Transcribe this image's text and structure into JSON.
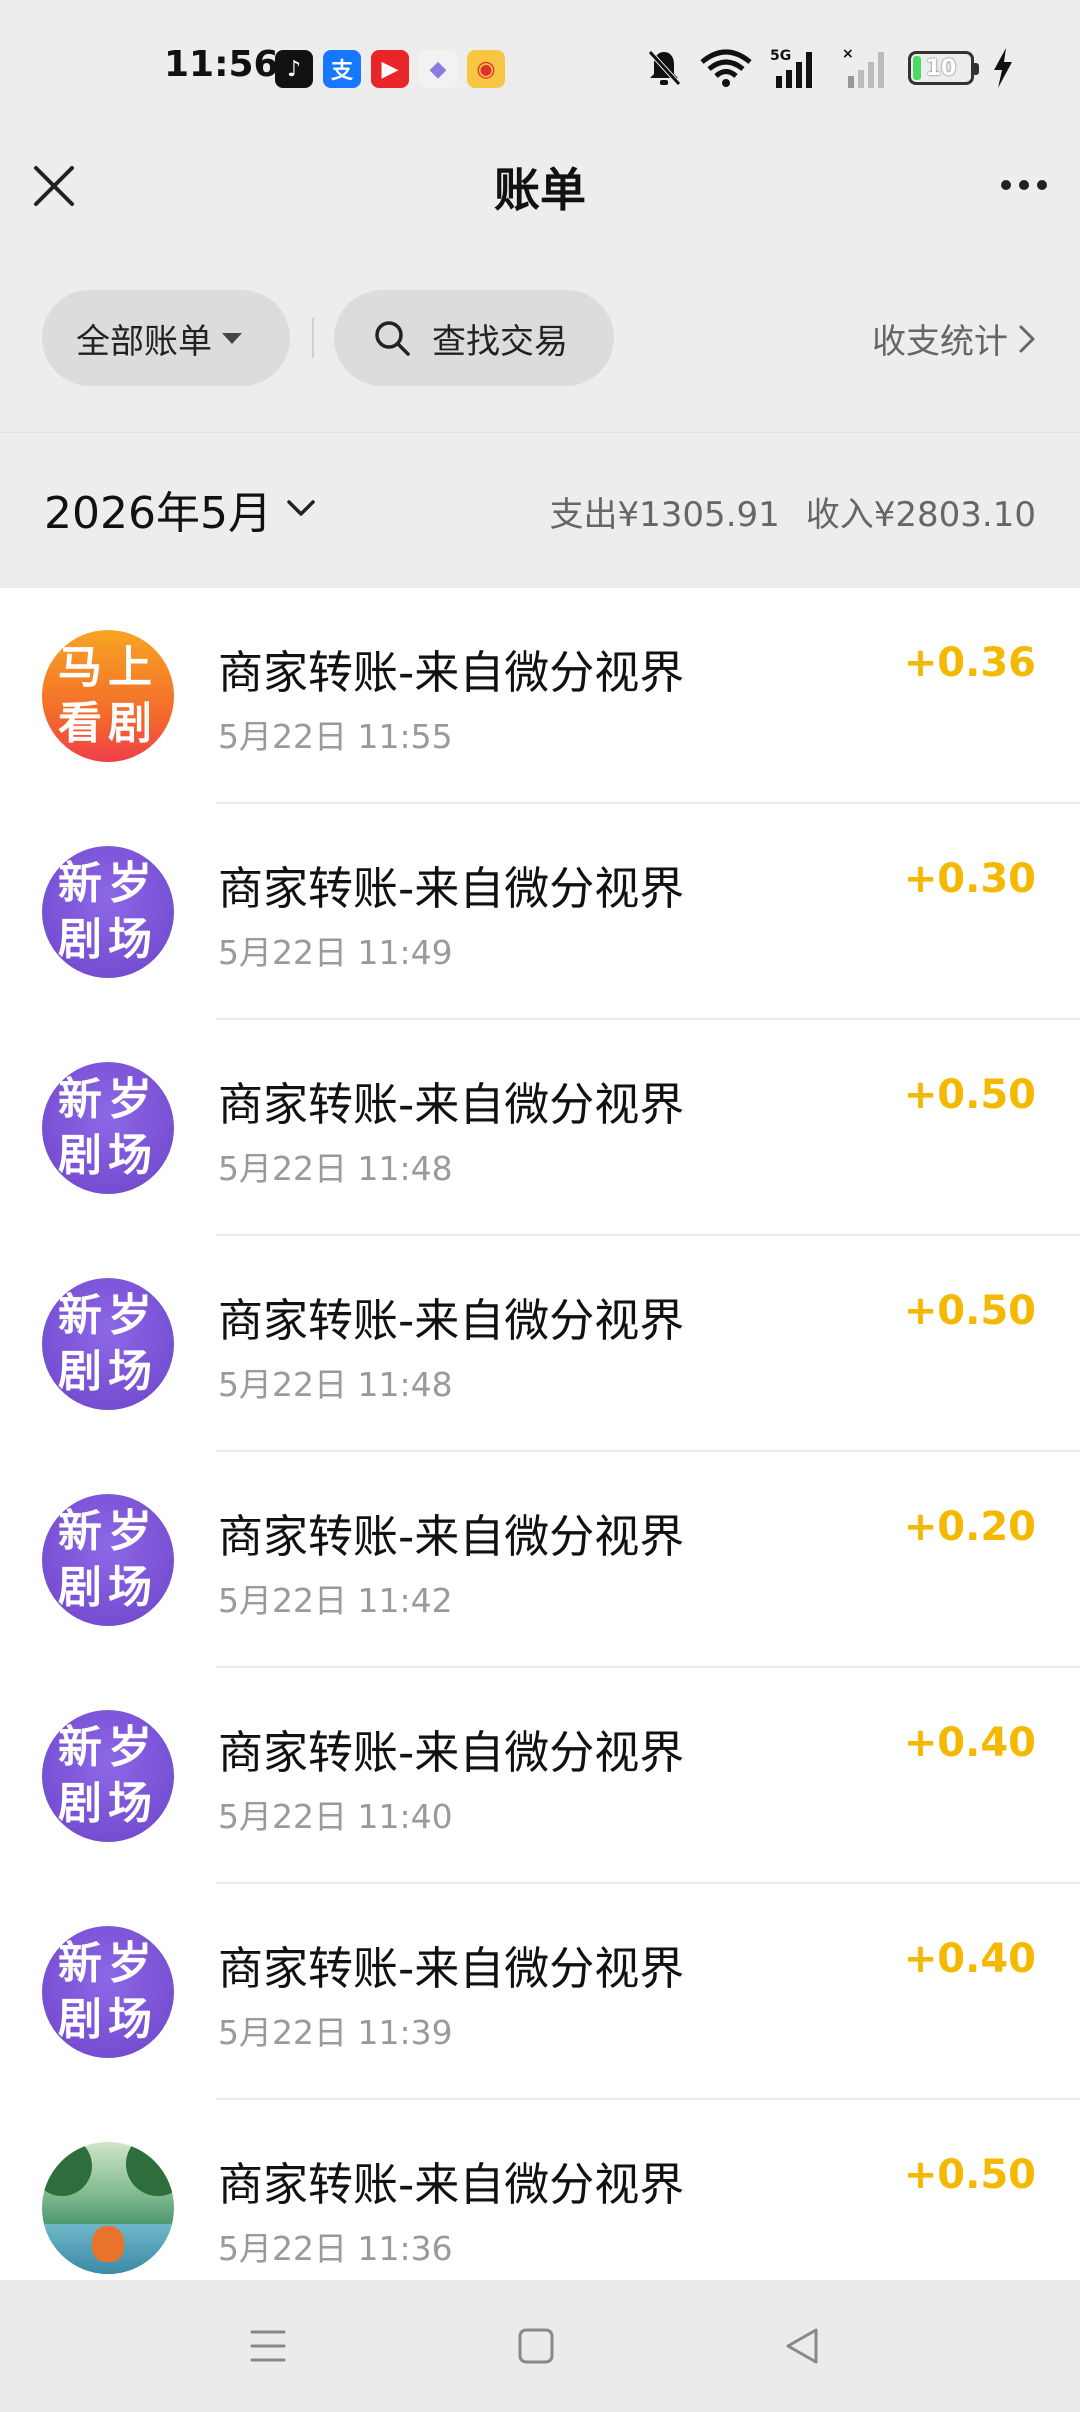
{
  "status_bar": {
    "time": "11:56",
    "apps": [
      {
        "icon": "douyin-icon",
        "glyph": "♪",
        "color": "#111111"
      },
      {
        "icon": "alipay-icon",
        "glyph": "支",
        "color": "#1677ff"
      },
      {
        "icon": "video-app-icon",
        "glyph": "▶",
        "color": "#e8262a"
      },
      {
        "icon": "bubble-app-icon",
        "glyph": "◆",
        "color": "#f2f2f2"
      },
      {
        "icon": "weibo-icon",
        "glyph": "◉",
        "color": "#f7c744"
      }
    ],
    "network": "5G",
    "battery": "10"
  },
  "header": {
    "title": "账单"
  },
  "filters": {
    "all_bills": "全部账单",
    "search": "查找交易",
    "stats": "收支统计"
  },
  "month_bar": {
    "month": "2026年5月",
    "expense": "支出¥1305.91",
    "income": "收入¥2803.10"
  },
  "transactions": [
    {
      "avatar": "马上看剧",
      "title": "商家转账-来自微分视界",
      "date": "5月22日 11:55",
      "amount": "+0.36"
    },
    {
      "avatar": "新岁剧场",
      "title": "商家转账-来自微分视界",
      "date": "5月22日 11:49",
      "amount": "+0.30"
    },
    {
      "avatar": "新岁剧场",
      "title": "商家转账-来自微分视界",
      "date": "5月22日 11:48",
      "amount": "+0.50"
    },
    {
      "avatar": "新岁剧场",
      "title": "商家转账-来自微分视界",
      "date": "5月22日 11:48",
      "amount": "+0.50"
    },
    {
      "avatar": "新岁剧场",
      "title": "商家转账-来自微分视界",
      "date": "5月22日 11:42",
      "amount": "+0.20"
    },
    {
      "avatar": "新岁剧场",
      "title": "商家转账-来自微分视界",
      "date": "5月22日 11:40",
      "amount": "+0.40"
    },
    {
      "avatar": "新岁剧场",
      "title": "商家转账-来自微分视界",
      "date": "5月22日 11:39",
      "amount": "+0.40"
    },
    {
      "avatar": "",
      "title": "商家转账-来自微分视界",
      "date": "5月22日 11:36",
      "amount": "+0.50"
    }
  ],
  "colors": {
    "income_amount": "#f5b800",
    "background": "#ededed"
  }
}
